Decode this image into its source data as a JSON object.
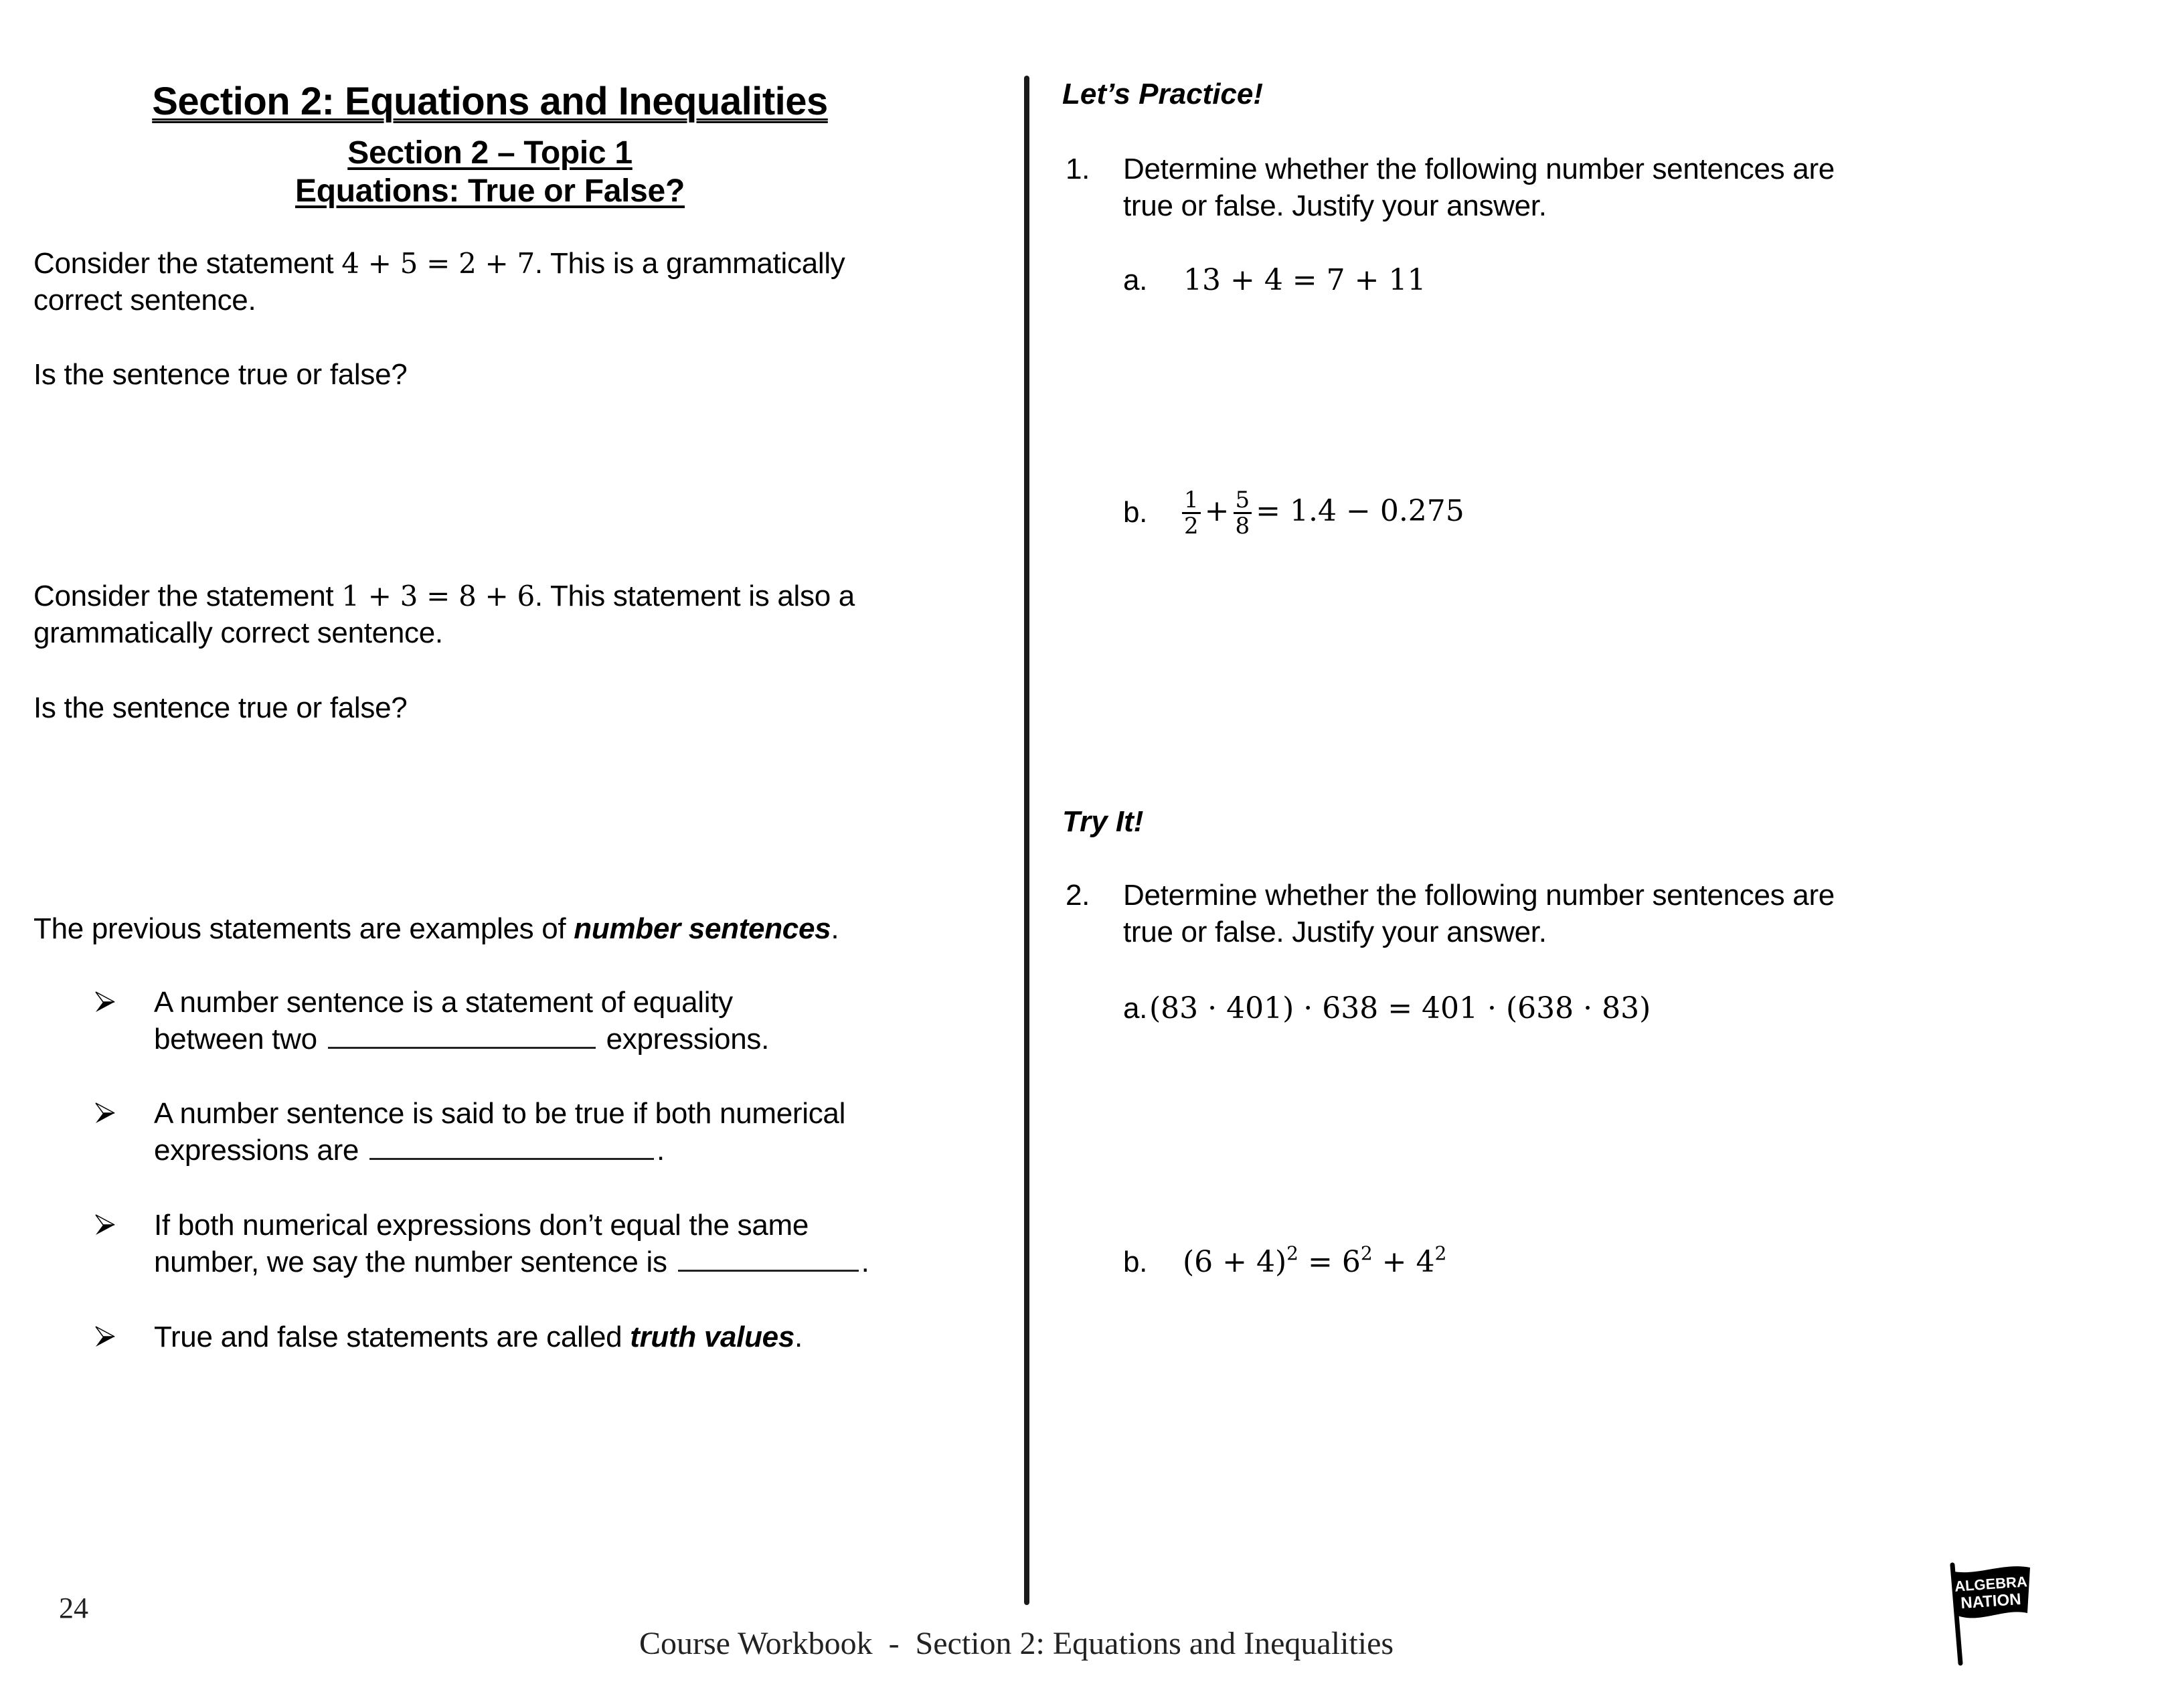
{
  "header": {
    "title": "Section 2: Equations and Inequalities",
    "topic": "Section 2 – Topic 1",
    "topic_title": "Equations: True or False?"
  },
  "left": {
    "statement1": {
      "prefix": "Consider the statement ",
      "math": "4 + 5 = 2 + 7",
      "suffix_line1": ". This is a grammatically",
      "line2": "correct sentence."
    },
    "question1": "Is the sentence true or false?",
    "statement2": {
      "prefix": "Consider the statement ",
      "math": "1 + 3 = 8 + 6",
      "suffix_line1": ". This statement is also a",
      "line2": "grammatically correct sentence."
    },
    "question2": "Is the sentence true or false?",
    "intro": {
      "prefix": "The previous statements are examples of ",
      "term": "number sentences",
      "suffix": "."
    },
    "bullets": [
      {
        "line1": "A number sentence is a statement of equality",
        "line2_prefix": "between two ",
        "line2_suffix": " expressions."
      },
      {
        "line1": "A number sentence is said to be true if both numerical",
        "line2_prefix": "expressions are ",
        "line2_suffix": "."
      },
      {
        "line1": "If both numerical expressions don’t equal the same",
        "line2_prefix": "number, we say the number sentence is ",
        "line2_suffix": "."
      },
      {
        "prefix": "True and false statements are called ",
        "term": "truth values",
        "suffix": "."
      }
    ],
    "bullet_icon": "arrowhead-bullet-icon"
  },
  "right": {
    "practice_heading": "Let’s Practice!",
    "problem1": {
      "number": "1.",
      "line1": "Determine whether the following number sentences are",
      "line2": "true or false. Justify your answer.",
      "parts": [
        {
          "label": "a.",
          "expr": "13 + 4 = 7 + 11"
        },
        {
          "label": "b.",
          "frac1_num": "1",
          "frac1_den": "2",
          "plus": "+",
          "frac2_num": "5",
          "frac2_den": "8",
          "rest": "= 1.4 − 0.275"
        }
      ]
    },
    "tryit_heading": "Try It!",
    "problem2": {
      "number": "2.",
      "line1": "Determine whether the following number sentences are",
      "line2": "true or false. Justify your answer.",
      "parts": [
        {
          "label": "a.",
          "expr": "(83 · 401) · 638 = 401 · (638 · 83)"
        },
        {
          "label": "b.",
          "base_left": "(6 + 4)",
          "exp_left": "2",
          "eq": " = 6",
          "exp_mid": "2",
          "plus": " + 4",
          "exp_right": "2"
        }
      ]
    }
  },
  "footer": {
    "page_number": "24",
    "text": "Course Workbook  -  Section 2: Equations and Inequalities",
    "logo_line1": "ALGEBRA",
    "logo_line2": "NATION"
  }
}
